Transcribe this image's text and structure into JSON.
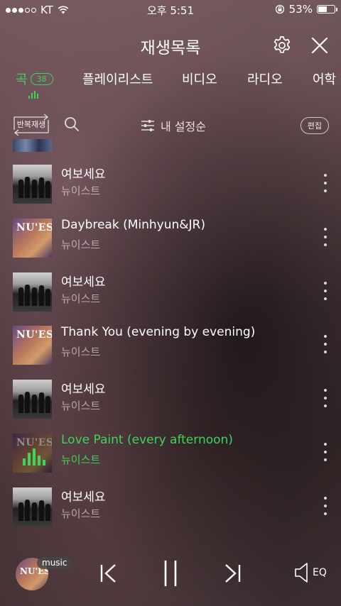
{
  "status_bar": {
    "carrier": "KT",
    "time": "오후 5:51",
    "battery_percent": "53%",
    "signal_dots_filled": 3,
    "battery_fill": 0.53
  },
  "header": {
    "title": "재생목록"
  },
  "tabs": [
    {
      "label": "곡",
      "badge": "38",
      "active": true
    },
    {
      "label": "플레이리스트"
    },
    {
      "label": "비디오"
    },
    {
      "label": "라디오"
    },
    {
      "label": "어학"
    }
  ],
  "toolbar": {
    "repeat_label": "반복재생",
    "sort_label": "내 설정순",
    "edit_label": "편집"
  },
  "songs": [
    {
      "title": "여보세요",
      "artist": "뉴이스트",
      "art": "a"
    },
    {
      "title": "Daybreak (Minhyun&JR)",
      "artist": "뉴이스트",
      "art": "b"
    },
    {
      "title": "여보세요",
      "artist": "뉴이스트",
      "art": "a"
    },
    {
      "title": "Thank You (evening by evening)",
      "artist": "뉴이스트",
      "art": "b"
    },
    {
      "title": "여보세요",
      "artist": "뉴이스트",
      "art": "a"
    },
    {
      "title": "Love Paint (every afternoon)",
      "artist": "뉴이스트",
      "art": "b",
      "playing": true
    },
    {
      "title": "여보세요",
      "artist": "뉴이스트",
      "art": "a"
    }
  ],
  "album_art_text": "NU'EST",
  "player": {
    "badge": "music",
    "eq_label": "EQ"
  },
  "colors": {
    "accent": "#3fd35a"
  }
}
